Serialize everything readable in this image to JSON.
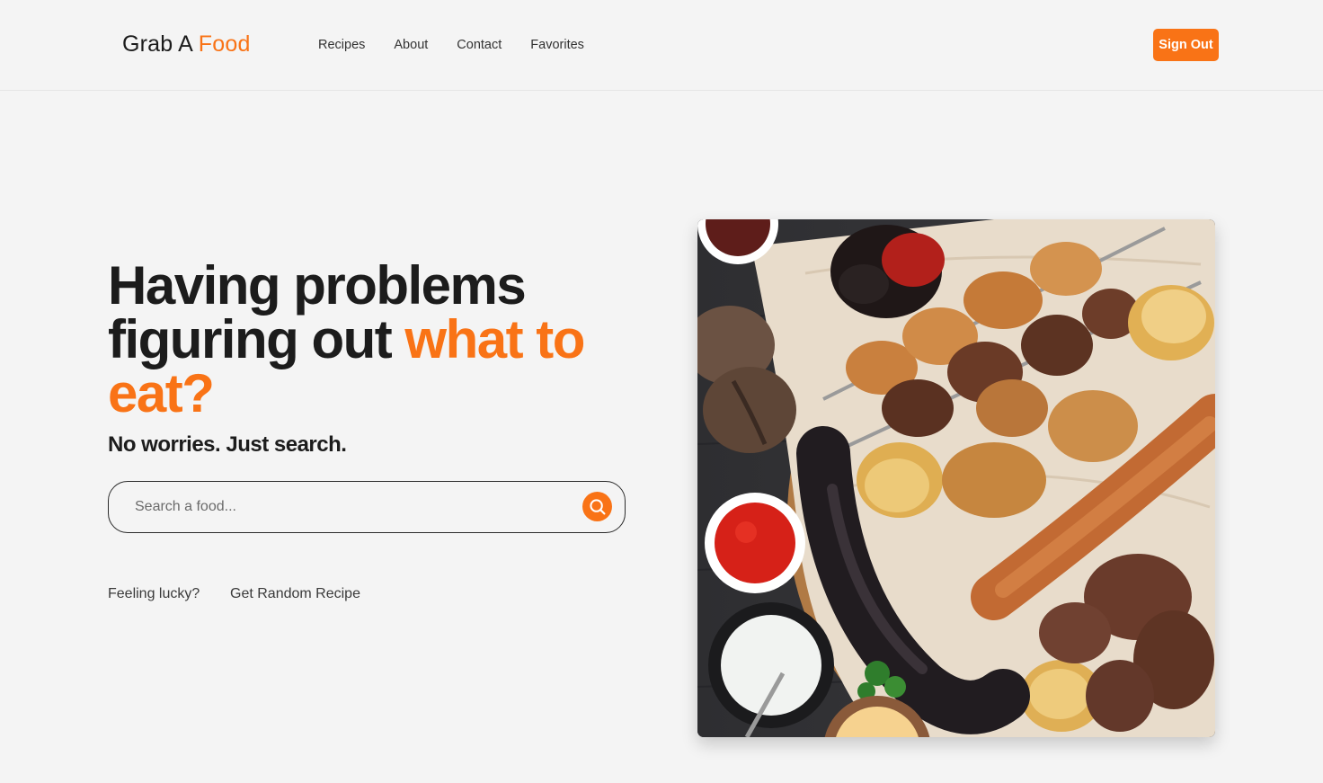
{
  "header": {
    "logo_main": "Grab A",
    "logo_accent": "Food",
    "nav": [
      "Recipes",
      "About",
      "Contact",
      "Favorites"
    ],
    "signout_label": "Sign Out"
  },
  "hero": {
    "title_line1": "Having problems",
    "title_line2_plain": "figuring out",
    "title_line2_accent": "what to",
    "title_line3_accent": "eat?",
    "subtitle": "No worries. Just search."
  },
  "search": {
    "placeholder": "Search a food...",
    "value": "",
    "button_icon": "search-icon"
  },
  "random": {
    "prompt": "Feeling lucky?",
    "link_label": "Get Random Recipe"
  },
  "image": {
    "content": "grilled-kebab-platter"
  },
  "colors": {
    "accent": "#f97316",
    "background": "#f4f4f4",
    "text": "#1c1c1c"
  }
}
